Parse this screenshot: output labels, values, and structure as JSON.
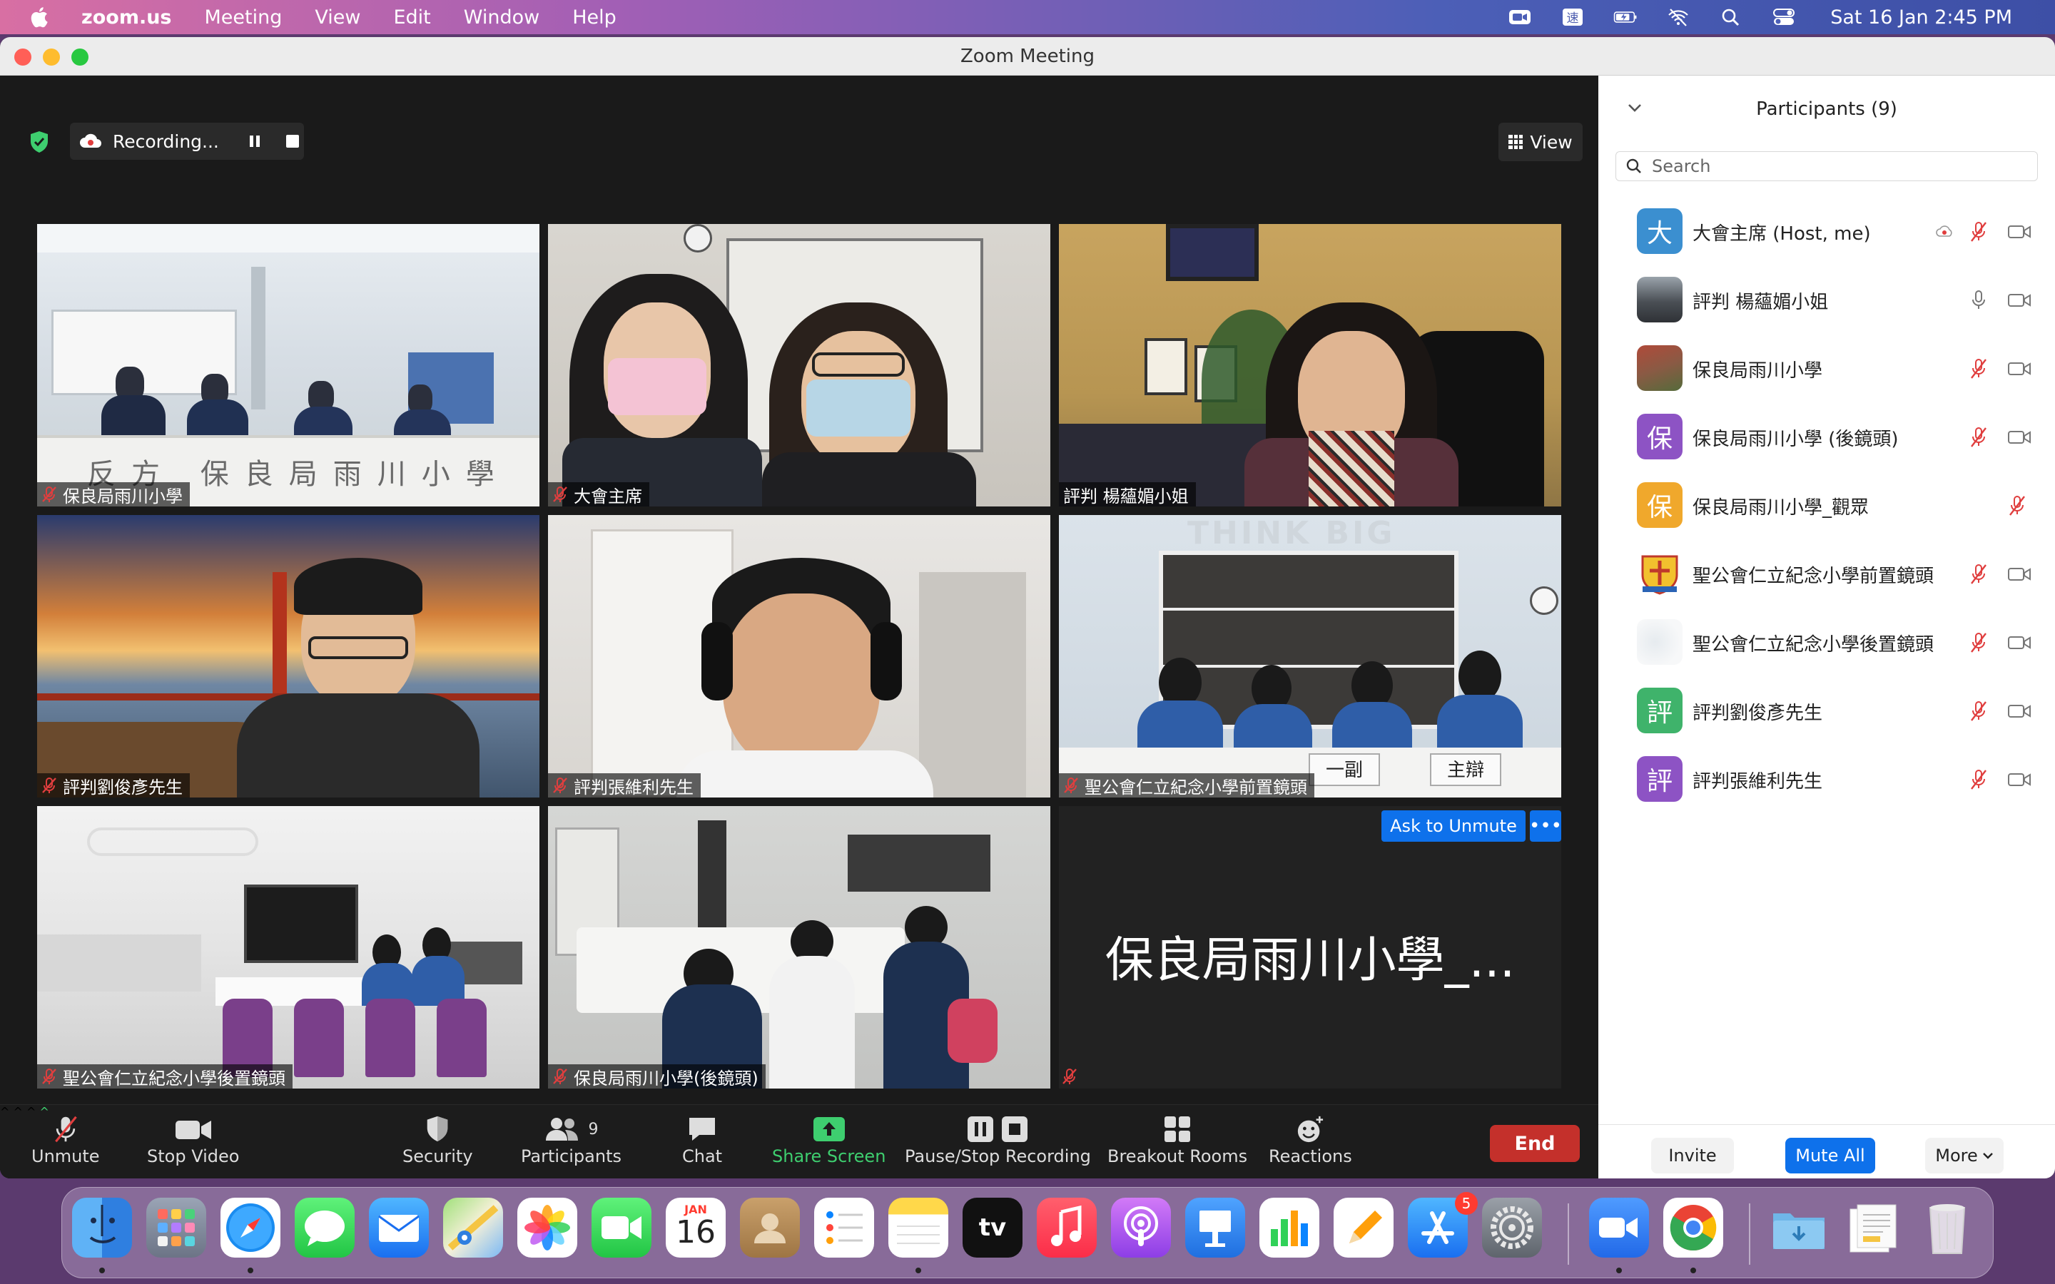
{
  "menubar": {
    "app_name": "zoom.us",
    "menus": [
      "Meeting",
      "View",
      "Edit",
      "Window",
      "Help"
    ],
    "clock": "Sat 16 Jan  2:45 PM",
    "status_icons": [
      "zoom-status-icon",
      "input-method-icon",
      "battery-icon",
      "wifi-off-icon",
      "spotlight-search-icon",
      "control-center-icon"
    ],
    "ime_glyph": "速"
  },
  "window": {
    "title": "Zoom Meeting",
    "recording_label": "Recording...",
    "view_label": "View"
  },
  "tiles": [
    {
      "name": "保良局雨川小學",
      "muted": true
    },
    {
      "name": "大會主席",
      "muted": true
    },
    {
      "name": "評判 楊蘊媚小姐",
      "muted": false,
      "active": true
    },
    {
      "name": "評判劉俊彥先生",
      "muted": true
    },
    {
      "name": "評判張維利先生",
      "muted": true
    },
    {
      "name": "聖公會仁立紀念小學前置鏡頭",
      "muted": true
    },
    {
      "name": "聖公會仁立紀念小學後置鏡頭",
      "muted": true
    },
    {
      "name": "保良局雨川小學(後鏡頭)",
      "muted": true
    },
    {
      "name": "保良局雨川小學_...",
      "muted": true,
      "video_off": true
    }
  ],
  "scene_text": {
    "banner": "反方 保良局雨川小學",
    "think_big": "THINK BIG",
    "name_card_1": "一副",
    "name_card_2": "主辯"
  },
  "tile_actions": {
    "ask_unmute": "Ask to Unmute",
    "more": "•••"
  },
  "toolbar": {
    "unmute": "Unmute",
    "stop_video": "Stop Video",
    "security": "Security",
    "participants": "Participants",
    "participants_count": "9",
    "chat": "Chat",
    "share_screen": "Share Screen",
    "pause_stop_recording": "Pause/Stop Recording",
    "breakout_rooms": "Breakout Rooms",
    "reactions": "Reactions",
    "end": "End",
    "caret": "^"
  },
  "participants_panel": {
    "title": "Participants (9)",
    "search_placeholder": "Search",
    "participants": [
      {
        "avatar": "大",
        "color": "#3b8fd0",
        "name": "大會主席 (Host, me)",
        "mic": "muted",
        "video": true,
        "recording": true
      },
      {
        "avatar": "",
        "color": "#6b6b6b",
        "name": "評判 楊蘊媚小姐",
        "mic": "on",
        "video": true
      },
      {
        "avatar": "",
        "color": "#8a5a44",
        "name": "保良局雨川小學",
        "mic": "muted",
        "video": true
      },
      {
        "avatar": "保",
        "color": "#8d53c4",
        "name": "保良局雨川小學 (後鏡頭)",
        "mic": "muted",
        "video": true
      },
      {
        "avatar": "保",
        "color": "#f0a82c",
        "name": "保良局雨川小學_觀眾",
        "mic": "muted",
        "video": false
      },
      {
        "avatar": "",
        "color": "#e8e2d0",
        "name": "聖公會仁立紀念小學前置鏡頭",
        "mic": "muted",
        "video": true
      },
      {
        "avatar": "",
        "color": "#f0f2f4",
        "name": "聖公會仁立紀念小學後置鏡頭",
        "mic": "muted",
        "video": true
      },
      {
        "avatar": "評",
        "color": "#3fb36b",
        "name": "評判劉俊彥先生",
        "mic": "muted",
        "video": true
      },
      {
        "avatar": "評",
        "color": "#8d53c4",
        "name": "評判張維利先生",
        "mic": "muted",
        "video": true
      }
    ],
    "invite": "Invite",
    "mute_all": "Mute All",
    "more": "More"
  },
  "dock": {
    "calendar_month": "JAN",
    "calendar_day": "16",
    "appstore_badge": "5",
    "tv_label": "tv",
    "apps": [
      "finder",
      "launchpad",
      "safari",
      "messages",
      "mail",
      "maps",
      "photos",
      "facetime",
      "calendar",
      "contacts",
      "reminders",
      "notes",
      "apple-tv",
      "music",
      "podcasts",
      "keynote",
      "numbers",
      "pages",
      "app-store",
      "system-preferences",
      "zoom",
      "chrome",
      "downloads",
      "documents",
      "trash"
    ]
  }
}
